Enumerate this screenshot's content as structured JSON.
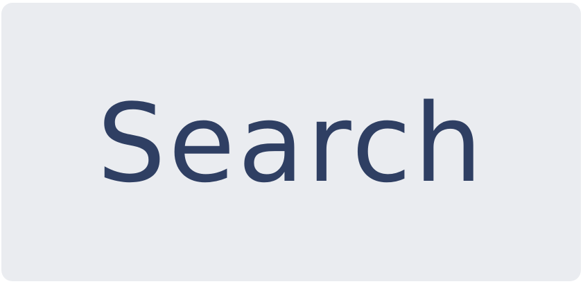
{
  "button": {
    "label": "Search"
  },
  "colors": {
    "background": "#ffffff",
    "button_background": "#eaecf0",
    "label_text": "#2f3f63"
  }
}
